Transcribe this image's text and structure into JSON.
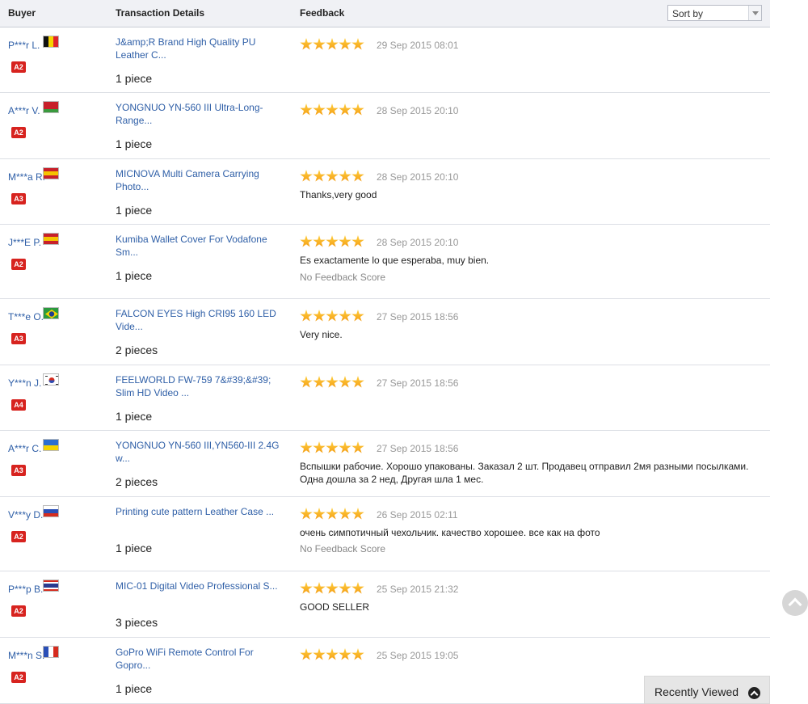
{
  "header": {
    "buyer": "Buyer",
    "transaction": "Transaction Details",
    "feedback": "Feedback",
    "sort_label": "Sort by"
  },
  "rows": [
    {
      "buyer": "P***r L.",
      "flag": "belgium",
      "level": "A2",
      "title": "J&amp;R Brand High Quality PU Leather C...",
      "qty": "1 piece",
      "stars": 5,
      "date": "29 Sep 2015 08:01",
      "comment": "",
      "note": ""
    },
    {
      "buyer": "A***r V.",
      "flag": "belarus",
      "level": "A2",
      "title": "YONGNUO YN-560 III Ultra-Long-Range...",
      "qty": "1 piece",
      "stars": 5,
      "date": "28 Sep 2015 20:10",
      "comment": "",
      "note": ""
    },
    {
      "buyer": "M***a R.",
      "flag": "spain",
      "level": "A3",
      "title": "MICNOVA Multi Camera Carrying Photo...",
      "qty": "1 piece",
      "stars": 5,
      "date": "28 Sep 2015 20:10",
      "comment": "Thanks,very good",
      "note": ""
    },
    {
      "buyer": "J***E P.",
      "flag": "spain",
      "level": "A2",
      "title": "Kumiba Wallet Cover For Vodafone Sm...",
      "qty": "1 piece",
      "stars": 5,
      "date": "28 Sep 2015 20:10",
      "comment": "Es exactamente lo que esperaba, muy bien.",
      "note": "No Feedback Score"
    },
    {
      "buyer": "T***e O.",
      "flag": "brazil",
      "level": "A3",
      "title": "FALCON EYES High CRI95 160 LED Vide...",
      "qty": "2 pieces",
      "stars": 5,
      "date": "27 Sep 2015 18:56",
      "comment": "Very nice.",
      "note": ""
    },
    {
      "buyer": "Y***n J.",
      "flag": "korea",
      "level": "A4",
      "title": "FEELWORLD FW-759 7&#39;&#39; Slim HD Video ...",
      "qty": "1 piece",
      "stars": 5,
      "date": "27 Sep 2015 18:56",
      "comment": "",
      "note": ""
    },
    {
      "buyer": "A***r C.",
      "flag": "ukraine",
      "level": "A3",
      "title": "YONGNUO YN-560 III,YN560-III 2.4G w...",
      "qty": "2 pieces",
      "stars": 5,
      "date": "27 Sep 2015 18:56",
      "comment": "Вспышки рабочие. Хорошо упакованы. Заказал 2 шт. Продавец отправил 2мя разными посылками. Одна дошла за 2 нед, Другая шла 1 мес.",
      "note": ""
    },
    {
      "buyer": "V***y D.",
      "flag": "russia",
      "level": "A2",
      "title": "Printing cute pattern Leather Case ...",
      "qty": "1 piece",
      "stars": 5,
      "date": "26 Sep 2015 02:11",
      "comment": "очень симпотичный чехольчик. качество хорошее. все как на фото",
      "note": "No Feedback Score"
    },
    {
      "buyer": "P***p B.",
      "flag": "thailand",
      "level": "A2",
      "title": "MIC-01 Digital Video Professional S...",
      "qty": "3 pieces",
      "stars": 5,
      "date": "25 Sep 2015 21:32",
      "comment": "GOOD SELLER",
      "note": ""
    },
    {
      "buyer": "M***n S.",
      "flag": "france",
      "level": "A2",
      "title": "GoPro WiFi Remote Control For Gopro...",
      "qty": "1 piece",
      "stars": 5,
      "date": "25 Sep 2015 19:05",
      "comment": "",
      "note": ""
    }
  ],
  "recently_viewed": "Recently Viewed",
  "colors": {
    "link": "#2f5fa7",
    "badge": "#d7231f",
    "star": "#f39a12"
  }
}
